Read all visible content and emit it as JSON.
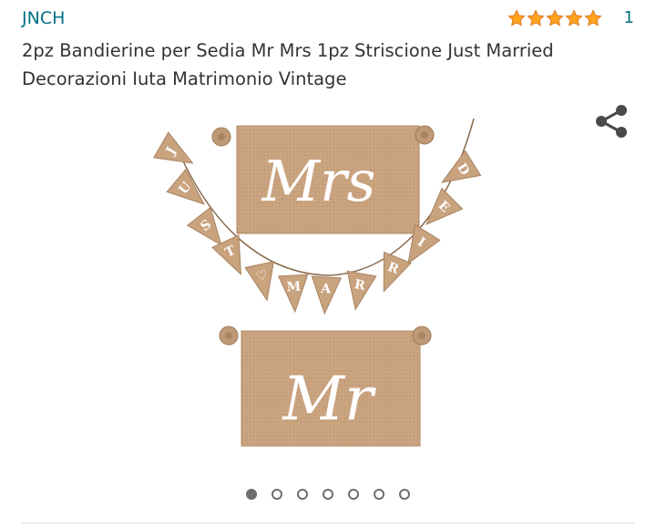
{
  "product": {
    "brand": "JNCH",
    "rating_count": "1",
    "stars_filled": 5,
    "stars_total": 5,
    "title": "2pz Bandierine per Sedia Mr Mrs 1pz Striscione Just Married Decorazioni Iuta Matrimonio Vintage"
  },
  "image": {
    "sign_top": "Mrs",
    "sign_bottom": "Mr",
    "banner_letters": [
      "J",
      "U",
      "S",
      "T",
      "♡",
      "M",
      "A",
      "R",
      "R",
      "I",
      "E",
      "D"
    ]
  },
  "carousel": {
    "total": 7,
    "active_index": 0
  },
  "colors": {
    "link": "#007185",
    "star": "#ffa41c",
    "burlap": "#c9a27e",
    "dot": "#6e6e6e"
  },
  "icons": {
    "share": "share-icon",
    "star": "star-icon"
  }
}
